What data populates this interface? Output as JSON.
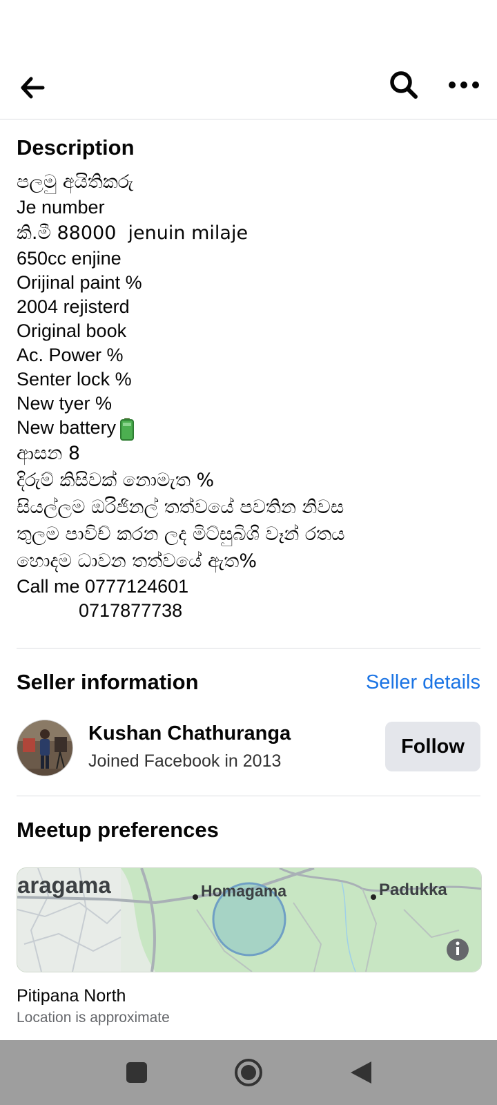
{
  "header": {
    "back_icon": "arrow-left-icon",
    "search_icon": "search-icon",
    "more_icon": "more-horizontal-icon"
  },
  "description": {
    "title": "Description",
    "lines": [
      "පලමු අයිතිකරු",
      "Je number",
      "කි.මී 88000  jenuin milaje",
      "650cc enjine",
      "Orijinal paint %",
      "2004 rejisterd",
      "Original book",
      "Ac. Power %",
      "Senter lock %",
      "New tyer %",
      "New battery",
      "ආසන 8",
      "දිරුම් කිසිවක් නොමැත %",
      "සියල්ලම ඔරිජිනල් තත්වයේ පවතින නිවස",
      "තුලම පාවිච් කරන ලද මිට්සුබිශි වෑන් රතය",
      "හොදම ධාවන තත්වයේ ඇත%",
      "Call me 0777124601",
      "            0717877738"
    ],
    "battery_icon": "battery-icon"
  },
  "seller": {
    "title": "Seller information",
    "details_link": "Seller details",
    "name": "Kushan Chathuranga",
    "joined": "Joined Facebook in 2013",
    "follow_label": "Follow"
  },
  "meetup": {
    "title": "Meetup preferences",
    "map_labels": {
      "left": "aragama",
      "center": "Homagama",
      "right": "Padukka"
    },
    "location": "Pitipana North",
    "note": "Location is approximate",
    "info_icon": "info-icon"
  },
  "navbar": {
    "recents_icon": "square-icon",
    "home_icon": "circle-icon",
    "back_icon": "triangle-back-icon"
  },
  "colors": {
    "link": "#1b74e4",
    "button_bg": "#e4e6eb",
    "divider": "#dadde1",
    "map_green": "#c8e6c3",
    "navbar": "#9e9e9e"
  }
}
